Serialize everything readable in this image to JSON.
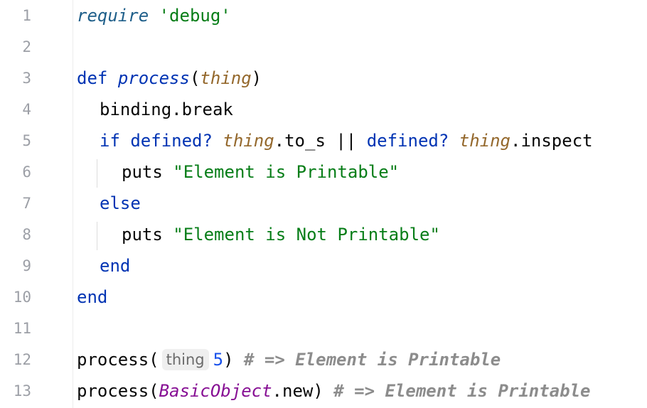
{
  "editor": {
    "lines": [
      {
        "n": "1",
        "t": [
          "require",
          " ",
          "'debug'"
        ]
      },
      {
        "n": "2"
      },
      {
        "n": "3",
        "t": [
          "def",
          " ",
          "process",
          "(",
          "thing",
          ")"
        ]
      },
      {
        "n": "4",
        "t": [
          "binding.break"
        ]
      },
      {
        "n": "5",
        "t": [
          "if",
          " ",
          "defined?",
          " ",
          "thing",
          ".to_s || ",
          "defined?",
          " ",
          "thing",
          ".inspect"
        ]
      },
      {
        "n": "6",
        "t": [
          "puts",
          " ",
          "\"Element is Printable\""
        ]
      },
      {
        "n": "7",
        "t": [
          "else"
        ]
      },
      {
        "n": "8",
        "t": [
          "puts",
          " ",
          "\"Element is Not Printable\""
        ]
      },
      {
        "n": "9",
        "t": [
          "end"
        ]
      },
      {
        "n": "10",
        "t": [
          "end"
        ]
      },
      {
        "n": "11"
      },
      {
        "n": "12",
        "t": [
          "process(",
          "thing",
          "5",
          ") ",
          "# => Element is Printable"
        ]
      },
      {
        "n": "13",
        "t": [
          "process(",
          "BasicObject",
          ".new) ",
          "# => Element is Printable"
        ]
      }
    ]
  }
}
